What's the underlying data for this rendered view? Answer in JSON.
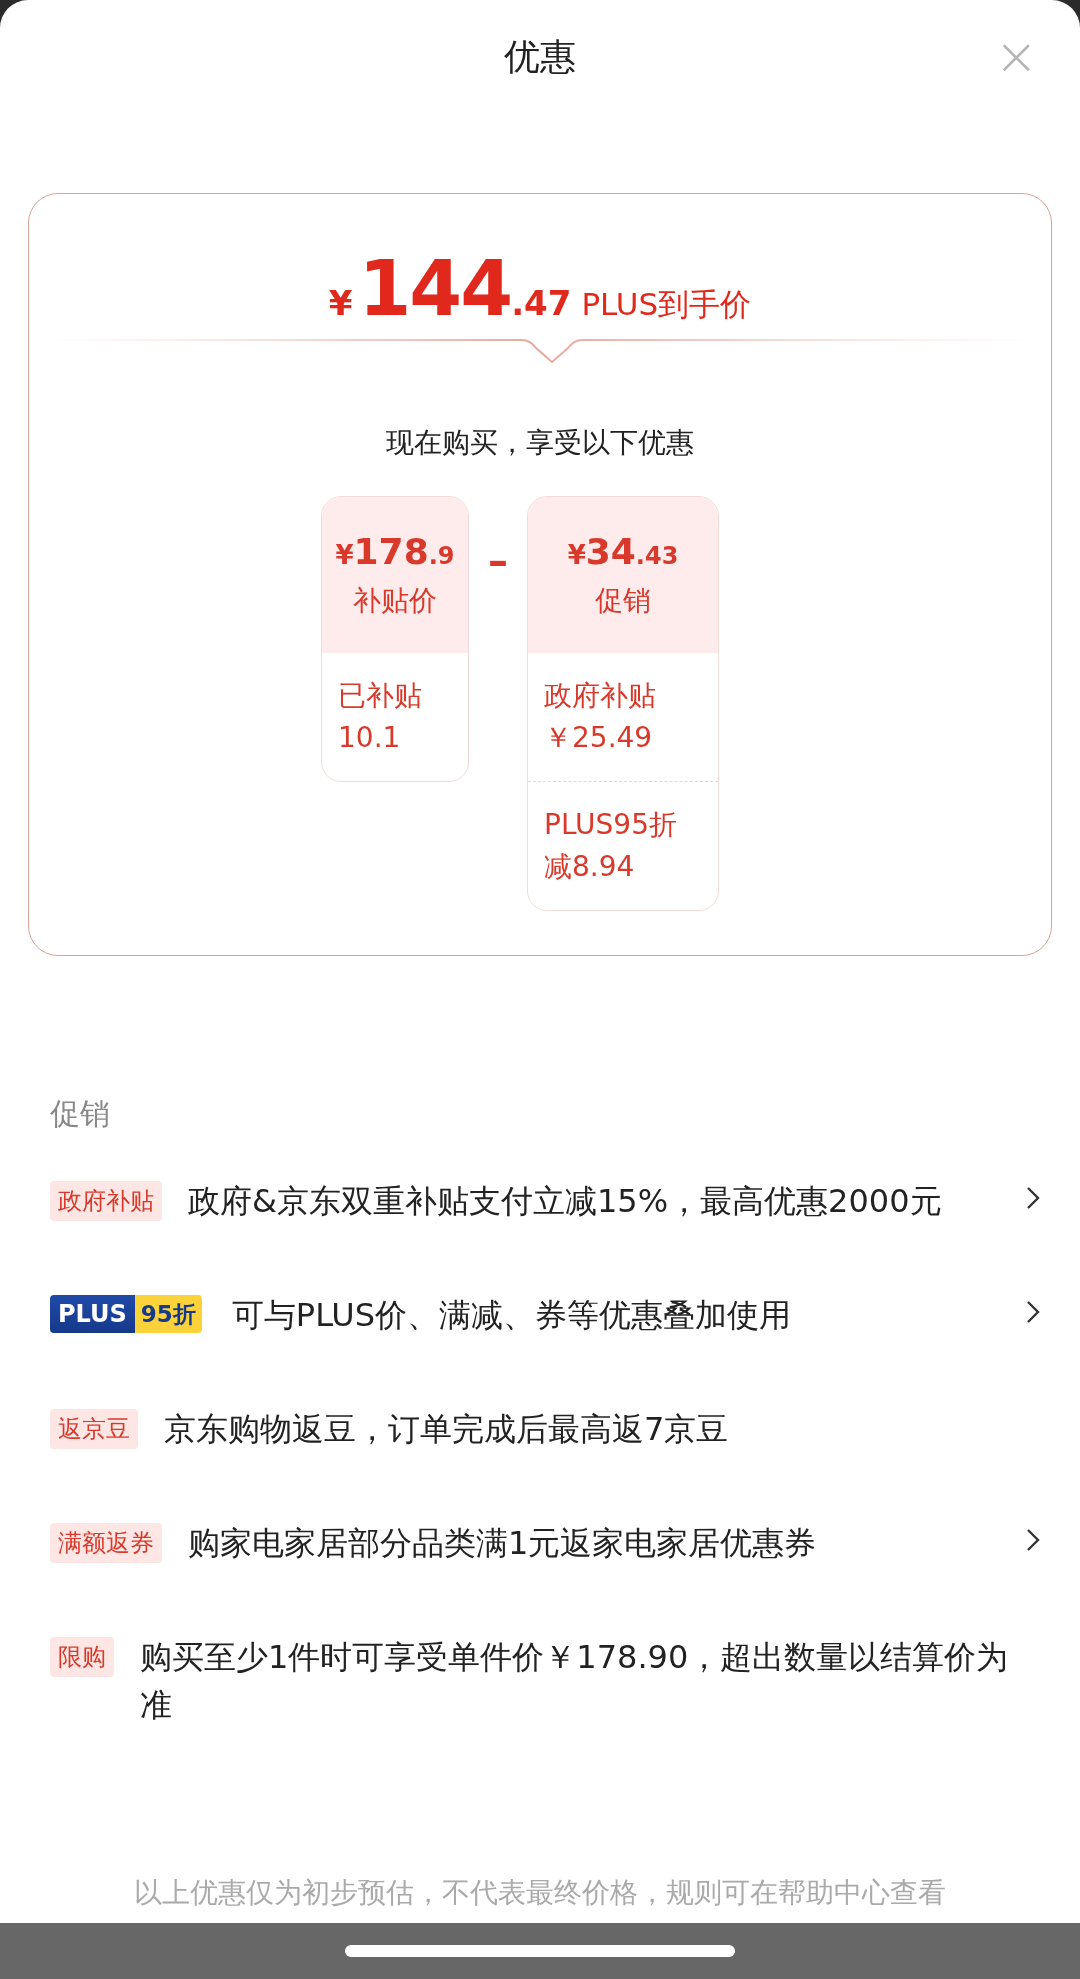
{
  "header": {
    "title": "优惠",
    "close": "×"
  },
  "summary": {
    "currency": "¥",
    "price_integer": "144",
    "price_decimal": ".47",
    "price_label": "PLUS到手价",
    "subtitle": "现在购买，享受以下优惠",
    "operator": "–",
    "blocks": [
      {
        "currency": "¥",
        "amount_integer": "178",
        "amount_decimal": ".9",
        "label": "补贴价",
        "details": [
          {
            "lines": [
              "已补贴",
              "10.1"
            ]
          }
        ]
      },
      {
        "currency": "¥",
        "amount_integer": "34",
        "amount_decimal": ".43",
        "label": "促销",
        "details": [
          {
            "lines": [
              "政府补贴",
              "￥25.49"
            ]
          },
          {
            "lines": [
              "PLUS95折",
              "减8.94"
            ]
          }
        ]
      }
    ]
  },
  "promotions": {
    "heading": "促销",
    "rows": [
      {
        "kind": "tag",
        "tag": "政府补贴",
        "text": "政府&京东双重补贴支付立减15%，最高优惠2000元",
        "has_arrow": true
      },
      {
        "kind": "plus",
        "tag_brand": "PLUS",
        "tag_discount": "95折",
        "text": "可与PLUS价、满减、券等优惠叠加使用",
        "has_arrow": true
      },
      {
        "kind": "tag",
        "tag": "返京豆",
        "text": "京东购物返豆，订单完成后最高返7京豆",
        "has_arrow": false
      },
      {
        "kind": "tag",
        "tag": "满额返券",
        "text": "购家电家居部分品类满1元返家电家居优惠券",
        "has_arrow": true
      },
      {
        "kind": "tag",
        "tag": "限购",
        "text": "购买至少1件时可享受单件价￥178.90，超出数量以结算价为准",
        "has_arrow": false
      }
    ]
  },
  "footer": {
    "note": "以上优惠仅为初步预估，不代表最终价格，规则可在帮助中心查看"
  }
}
